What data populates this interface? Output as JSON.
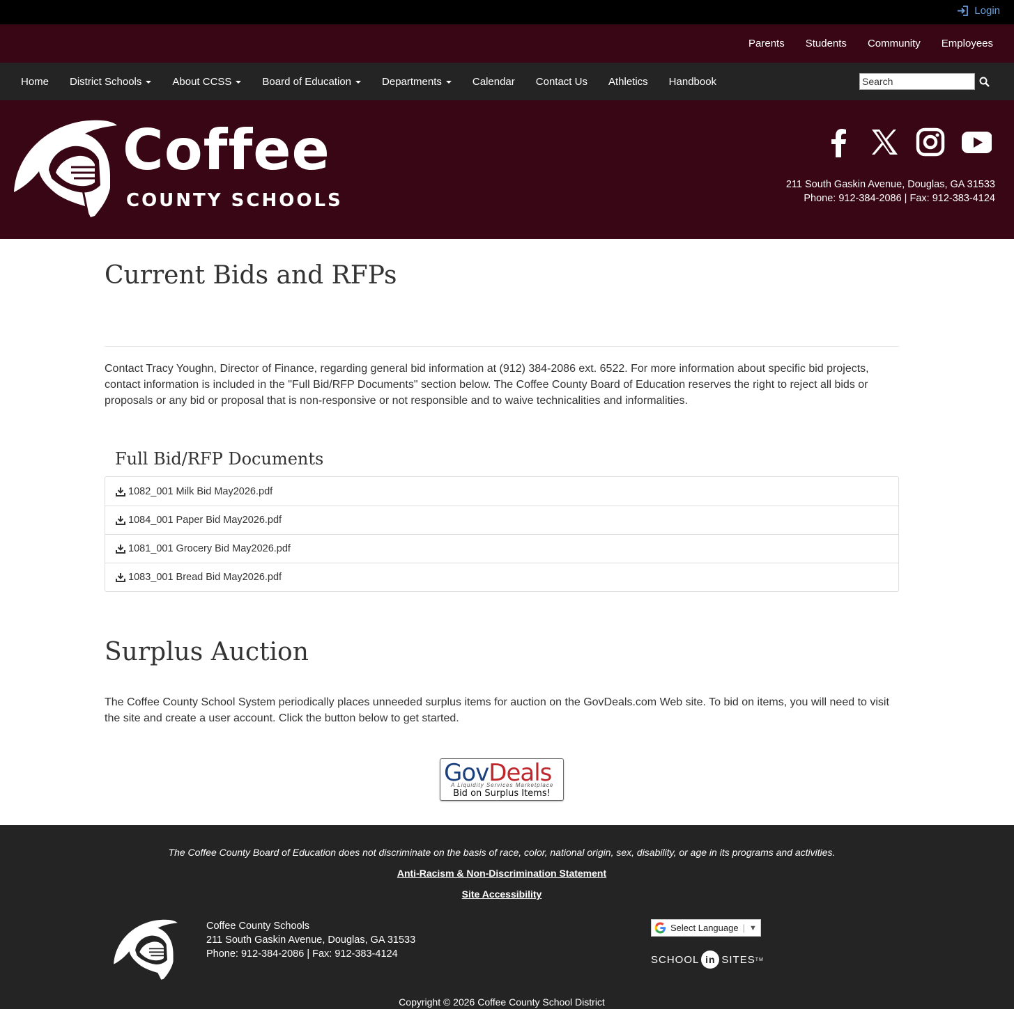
{
  "topbar": {
    "login_label": "Login"
  },
  "audience_nav": [
    "Parents",
    "Students",
    "Community",
    "Employees"
  ],
  "main_nav": [
    {
      "label": "Home",
      "dropdown": false
    },
    {
      "label": "District Schools",
      "dropdown": true
    },
    {
      "label": "About CCSS",
      "dropdown": true
    },
    {
      "label": "Board of Education",
      "dropdown": true
    },
    {
      "label": "Departments",
      "dropdown": true
    },
    {
      "label": "Calendar",
      "dropdown": false
    },
    {
      "label": "Contact Us",
      "dropdown": false
    },
    {
      "label": "Athletics",
      "dropdown": false
    },
    {
      "label": "Handbook",
      "dropdown": false
    }
  ],
  "search": {
    "value": "Search"
  },
  "header": {
    "logo_title": "Coffee",
    "logo_subtitle": "COUNTY SCHOOLS",
    "address": "211 South Gaskin Avenue, Douglas, GA 31533",
    "phone_fax": "Phone: 912-384-2086 | Fax: 912-383-4124",
    "social_icons": [
      "facebook-icon",
      "x-icon",
      "instagram-icon",
      "youtube-icon"
    ]
  },
  "content": {
    "title": "Current Bids and RFPs",
    "intro": "Contact Tracy Youghn, Director of Finance, regarding general bid information at (912) 384-2086 ext. 6522.  For more information about specific bid projects, contact information is included in the \"Full Bid/RFP Documents\"  section below.  The Coffee County Board of Education reserves the right to reject all bids or proposals or any bid or proposal that is non-responsive or not responsible and to waive technicalities and informalities.",
    "documents_heading": "Full Bid/RFP Documents",
    "documents": [
      "1082_001 Milk Bid May2026.pdf",
      "1084_001 Paper Bid May2026.pdf",
      "1081_001 Grocery Bid May2026.pdf",
      "1083_001 Bread Bid May2026.pdf"
    ],
    "surplus_title": "Surplus Auction",
    "surplus_text": "The Coffee County School System periodically places unneeded surplus items for auction on the GovDeals.com Web site. To bid on items, you will need to visit the site and create a user account. Click the button below to get started.",
    "govdeals": {
      "gov": "Gov",
      "deals": "Deals",
      "tagline": "A Liquidity Services Marketplace",
      "bid": "Bid on Surplus Items!"
    }
  },
  "footer": {
    "notice": "The Coffee County Board of Education does not discriminate on the basis of race, color, national origin, sex, disability, or age in its programs and activities.",
    "link_statement": "Anti-Racism & Non-Discrimination Statement",
    "link_accessibility": "Site Accessibility",
    "org_name": "Coffee County Schools",
    "address": "211 South Gaskin Avenue, Douglas, GA 31533",
    "phone_fax": "Phone: 912-384-2086 | Fax: 912-383-4124",
    "language_label": "Select Language",
    "sis_school": "SCHOOL",
    "sis_in": "in",
    "sis_sites": "SITES",
    "sis_tm": "TM",
    "copyright": "Copyright © 2026 Coffee County School District"
  },
  "colors": {
    "maroon": "#380615",
    "nav_dark": "#242424",
    "login_blue": "#6a9cd8"
  }
}
